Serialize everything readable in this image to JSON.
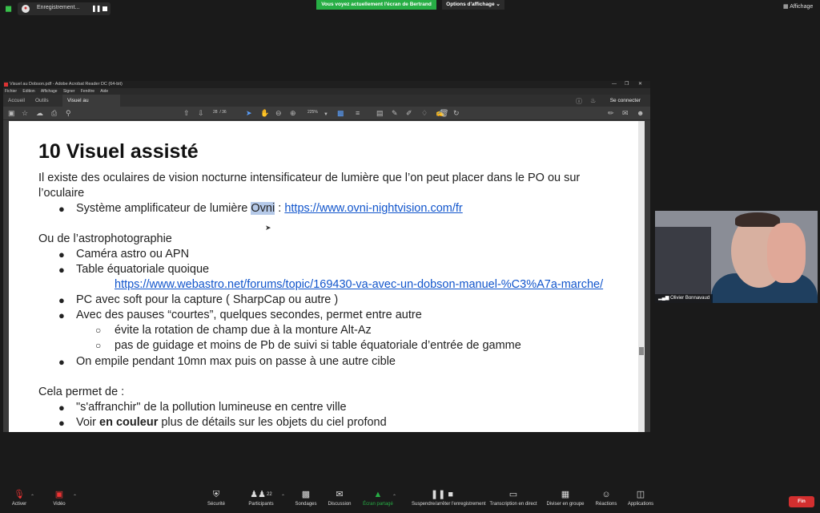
{
  "zoom_top": {
    "recording_label": "Enregistrement...",
    "share_banner": "Vous voyez actuellement l'écran de Bertrand",
    "view_options": "Options d'affichage ⌄",
    "view_button": "Affichage"
  },
  "acrobat": {
    "title": "Visuel au Dobson.pdf - Adobe Acrobat Reader DC (64-bit)",
    "menu": [
      "Fichier",
      "Edition",
      "Affichage",
      "Signer",
      "Fenêtre",
      "Aide"
    ],
    "tabs": [
      "Accueil",
      "Outils",
      "Visuel au Dobson.p..."
    ],
    "connect": "Se connecter",
    "page_current": "28",
    "page_total": "/ 36",
    "zoom": "225%"
  },
  "document": {
    "title": "10 Visuel assisté",
    "intro_1": "Il existe des oculaires de vision nocturne intensificateur de lumière que l’on peut placer dans le PO ou sur",
    "intro_2": "l’oculaire",
    "b1_prefix": "Système amplificateur de lumière ",
    "b1_highlight": "Ovni",
    "b1_sep": " : ",
    "b1_link": "https://www.ovni-nightvision.com/fr",
    "astro_heading": "Ou de l’astrophotographie",
    "b2": "Caméra astro ou APN",
    "b3": "Table équatoriale quoique",
    "b3_link": "https://www.webastro.net/forums/topic/169430-va-avec-un-dobson-manuel-%C3%A7a-marche/",
    "b4": "PC avec soft pour la capture ( SharpCap ou autre )",
    "b5": "Avec des pauses “courtes”, quelques secondes, permet entre autre",
    "s1": "évite la rotation de champ due à la monture Alt-Az",
    "s2": "pas de guidage et moins de Pb de suivi si table équatoriale d’entrée de gamme",
    "b6": "On empile pendant 10mn max puis on passe à une autre cible",
    "result_heading": "Cela permet de :",
    "r1": "\"s'affranchir\" de la pollution lumineuse en centre ville",
    "r2_prefix": "Voir ",
    "r2_bold": "en couleur",
    "r2_suffix": " plus de détails sur les objets du ciel profond"
  },
  "video": {
    "participant_name": "Olivier Bonnavaud"
  },
  "bottom_bar": {
    "unmute": "Activer",
    "video": "Vidéo",
    "security": "Sécurité",
    "participants": "Participants",
    "participants_count": "22",
    "polls": "Sondages",
    "chat": "Discussion",
    "share": "Écran partagé",
    "record": "Suspendre/arrêter l'enregistrement",
    "live_transcript": "Transcription en direct",
    "breakout": "Diviser en groupe",
    "reactions": "Réactions",
    "apps": "Applications",
    "end": "Fin"
  },
  "colors": {
    "share_green": "#27ae45",
    "end_red": "#d32f2f",
    "link_blue": "#1155cc",
    "highlight": "#b5c9e8"
  }
}
